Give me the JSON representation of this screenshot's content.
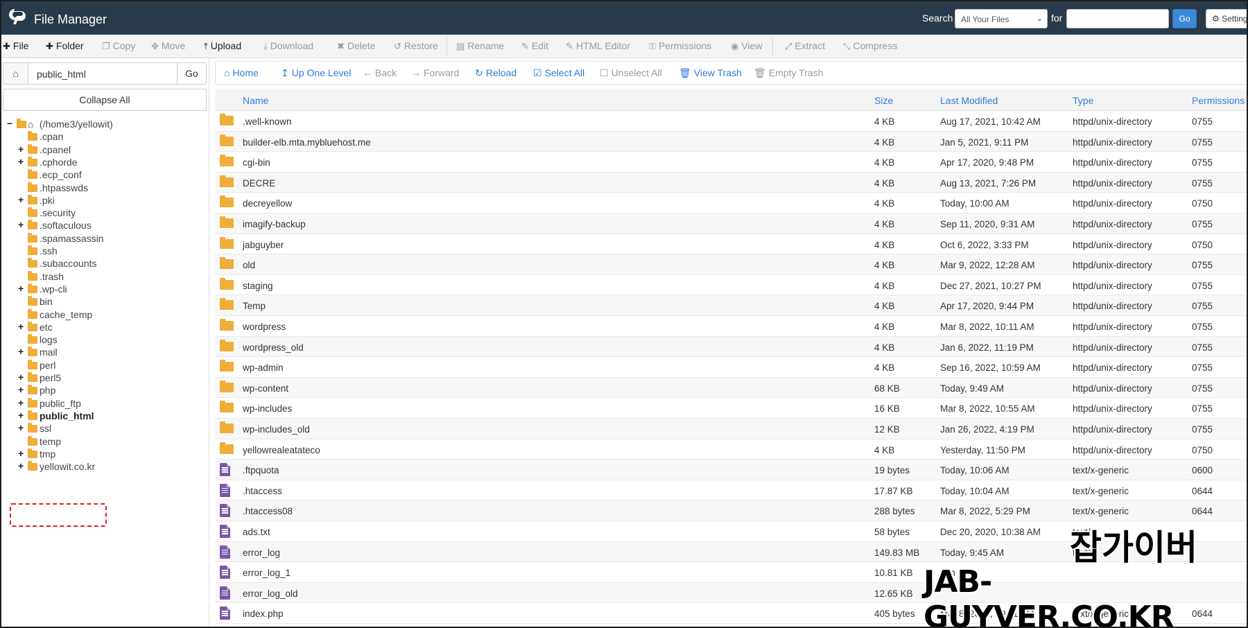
{
  "header": {
    "app_title": "File Manager",
    "search_label": "Search",
    "search_scope_selected": "All Your Files",
    "for_label": "for",
    "search_value": "",
    "go_label": "Go",
    "settings_label": "Settings"
  },
  "toolbar": {
    "file": "File",
    "folder": "Folder",
    "copy": "Copy",
    "move": "Move",
    "upload": "Upload",
    "download": "Download",
    "delete": "Delete",
    "restore": "Restore",
    "rename": "Rename",
    "edit": "Edit",
    "html_editor": "HTML Editor",
    "permissions": "Permissions",
    "view": "View",
    "extract": "Extract",
    "compress": "Compress"
  },
  "sidebar": {
    "path_value": "public_html",
    "go_label": "Go",
    "collapse_all": "Collapse All",
    "root_label": "(/home3/yellowit)",
    "tree": [
      {
        "label": ".cpan",
        "expandable": false
      },
      {
        "label": ".cpanel",
        "expandable": true
      },
      {
        "label": ".cphorde",
        "expandable": true
      },
      {
        "label": ".ecp_conf",
        "expandable": false
      },
      {
        "label": ".htpasswds",
        "expandable": false
      },
      {
        "label": ".pki",
        "expandable": true
      },
      {
        "label": ".security",
        "expandable": false
      },
      {
        "label": ".softaculous",
        "expandable": true
      },
      {
        "label": ".spamassassin",
        "expandable": false
      },
      {
        "label": ".ssh",
        "expandable": false
      },
      {
        "label": ".subaccounts",
        "expandable": false
      },
      {
        "label": ".trash",
        "expandable": false
      },
      {
        "label": ".wp-cli",
        "expandable": true
      },
      {
        "label": "bin",
        "expandable": false
      },
      {
        "label": "cache_temp",
        "expandable": false
      },
      {
        "label": "etc",
        "expandable": true
      },
      {
        "label": "logs",
        "expandable": false
      },
      {
        "label": "mail",
        "expandable": true
      },
      {
        "label": "perl",
        "expandable": false
      },
      {
        "label": "perl5",
        "expandable": true
      },
      {
        "label": "php",
        "expandable": true
      },
      {
        "label": "public_ftp",
        "expandable": true
      },
      {
        "label": "public_html",
        "expandable": true,
        "selected": true
      },
      {
        "label": "ssl",
        "expandable": true
      },
      {
        "label": "temp",
        "expandable": false
      },
      {
        "label": "tmp",
        "expandable": true
      },
      {
        "label": "yellowit.co.kr",
        "expandable": true
      }
    ]
  },
  "nav": {
    "home": "Home",
    "up_one_level": "Up One Level",
    "back": "Back",
    "forward": "Forward",
    "reload": "Reload",
    "select_all": "Select All",
    "unselect_all": "Unselect All",
    "view_trash": "View Trash",
    "empty_trash": "Empty Trash"
  },
  "table": {
    "columns": [
      "Name",
      "Size",
      "Last Modified",
      "Type",
      "Permissions"
    ],
    "rows": [
      {
        "kind": "folder",
        "name": ".well-known",
        "size": "4 KB",
        "modified": "Aug 17, 2021, 10:42 AM",
        "type": "httpd/unix-directory",
        "perms": "0755"
      },
      {
        "kind": "folder",
        "name": "builder-elb.mta.mybluehost.me",
        "size": "4 KB",
        "modified": "Jan 5, 2021, 9:11 PM",
        "type": "httpd/unix-directory",
        "perms": "0755"
      },
      {
        "kind": "folder",
        "name": "cgi-bin",
        "size": "4 KB",
        "modified": "Apr 17, 2020, 9:48 PM",
        "type": "httpd/unix-directory",
        "perms": "0755"
      },
      {
        "kind": "folder",
        "name": "DECRE",
        "size": "4 KB",
        "modified": "Aug 13, 2021, 7:26 PM",
        "type": "httpd/unix-directory",
        "perms": "0755"
      },
      {
        "kind": "folder",
        "name": "decreyellow",
        "size": "4 KB",
        "modified": "Today, 10:00 AM",
        "type": "httpd/unix-directory",
        "perms": "0750"
      },
      {
        "kind": "folder",
        "name": "imagify-backup",
        "size": "4 KB",
        "modified": "Sep 11, 2020, 9:31 AM",
        "type": "httpd/unix-directory",
        "perms": "0755"
      },
      {
        "kind": "folder",
        "name": "jabguyber",
        "size": "4 KB",
        "modified": "Oct 6, 2022, 3:33 PM",
        "type": "httpd/unix-directory",
        "perms": "0750"
      },
      {
        "kind": "folder",
        "name": "old",
        "size": "4 KB",
        "modified": "Mar 9, 2022, 12:28 AM",
        "type": "httpd/unix-directory",
        "perms": "0755"
      },
      {
        "kind": "folder",
        "name": "staging",
        "size": "4 KB",
        "modified": "Dec 27, 2021, 10:27 PM",
        "type": "httpd/unix-directory",
        "perms": "0755"
      },
      {
        "kind": "folder",
        "name": "Temp",
        "size": "4 KB",
        "modified": "Apr 17, 2020, 9:44 PM",
        "type": "httpd/unix-directory",
        "perms": "0755"
      },
      {
        "kind": "folder",
        "name": "wordpress",
        "size": "4 KB",
        "modified": "Mar 8, 2022, 10:11 AM",
        "type": "httpd/unix-directory",
        "perms": "0755"
      },
      {
        "kind": "folder",
        "name": "wordpress_old",
        "size": "4 KB",
        "modified": "Jan 6, 2022, 11:19 PM",
        "type": "httpd/unix-directory",
        "perms": "0755"
      },
      {
        "kind": "folder",
        "name": "wp-admin",
        "size": "4 KB",
        "modified": "Sep 16, 2022, 10:59 AM",
        "type": "httpd/unix-directory",
        "perms": "0755"
      },
      {
        "kind": "folder",
        "name": "wp-content",
        "size": "68 KB",
        "modified": "Today, 9:49 AM",
        "type": "httpd/unix-directory",
        "perms": "0755"
      },
      {
        "kind": "folder",
        "name": "wp-includes",
        "size": "16 KB",
        "modified": "Mar 8, 2022, 10:55 AM",
        "type": "httpd/unix-directory",
        "perms": "0755"
      },
      {
        "kind": "folder",
        "name": "wp-includes_old",
        "size": "12 KB",
        "modified": "Jan 26, 2022, 4:19 PM",
        "type": "httpd/unix-directory",
        "perms": "0755"
      },
      {
        "kind": "folder",
        "name": "yellowrealeatateco",
        "size": "4 KB",
        "modified": "Yesterday, 11:50 PM",
        "type": "httpd/unix-directory",
        "perms": "0750"
      },
      {
        "kind": "file",
        "name": ".ftpquota",
        "size": "19 bytes",
        "modified": "Today, 10:06 AM",
        "type": "text/x-generic",
        "perms": "0600"
      },
      {
        "kind": "file",
        "name": ".htaccess",
        "size": "17.87 KB",
        "modified": "Today, 10:04 AM",
        "type": "text/x-generic",
        "perms": "0644"
      },
      {
        "kind": "file",
        "name": ".htaccess08",
        "size": "288 bytes",
        "modified": "Mar 8, 2022, 5:29 PM",
        "type": "text/x-generic",
        "perms": "0644"
      },
      {
        "kind": "file",
        "name": "ads.txt",
        "size": "58 bytes",
        "modified": "Dec 20, 2020, 10:38 AM",
        "type": "text/p",
        "perms": ""
      },
      {
        "kind": "file",
        "name": "error_log",
        "size": "149.83 MB",
        "modified": "Today, 9:45 AM",
        "type": "text/x",
        "perms": ""
      },
      {
        "kind": "file",
        "name": "error_log_1",
        "size": "10.81 KB",
        "modified": "Jan",
        "type": "",
        "perms": ""
      },
      {
        "kind": "file",
        "name": "error_log_old",
        "size": "12.65 KB",
        "modified": "",
        "type": "",
        "perms": ""
      },
      {
        "kind": "file",
        "name": "index.php",
        "size": "405 bytes",
        "modified": "Mar 8, 2022, 10:11 AM",
        "type": "text/x-generic",
        "perms": "0644"
      }
    ]
  },
  "watermark": {
    "korean": "잡가이버",
    "english": "JAB-GUYVER.CO.KR"
  },
  "colors": {
    "header_bg": "#293a4a",
    "accent_blue": "#2c7dd6",
    "folder": "#f0ad3a",
    "file": "#7a58a8",
    "highlight": "#e0202b"
  }
}
